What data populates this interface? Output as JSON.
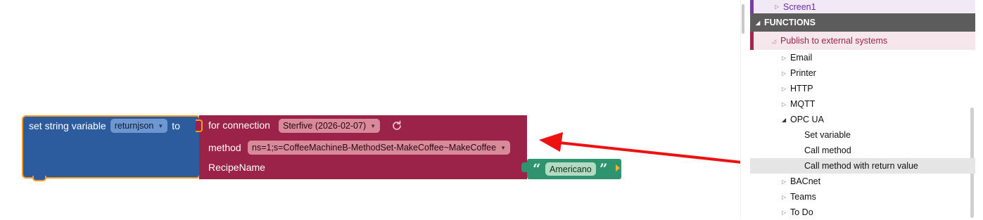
{
  "workspace": {
    "set_block": {
      "label_set": "set string variable",
      "variable": "returnjson",
      "label_to": "to"
    },
    "call_block": {
      "connection_label": "for connection",
      "connection_value": "Sterfive (2026-02-07)",
      "method_label": "method",
      "method_value": "ns=1;s=CoffeeMachineB-MethodSet-MakeCoffee~MakeCoffee",
      "param_label": "RecipeName"
    },
    "text_block": {
      "open_quote": "“",
      "value": "Americano",
      "close_quote": "”"
    },
    "colors": {
      "variable_block": "#2c5c9e",
      "opcua_block": "#9b2349",
      "text_block": "#2e9470",
      "selection_outline": "#f59a23",
      "arrow": "#ee1111"
    }
  },
  "toolbox": {
    "screen_item": "Screen1",
    "section_title": "FUNCTIONS",
    "category": "Publish to external systems",
    "items": [
      {
        "label": "Email",
        "expanded": false
      },
      {
        "label": "Printer",
        "expanded": false
      },
      {
        "label": "HTTP",
        "expanded": false
      },
      {
        "label": "MQTT",
        "expanded": false
      },
      {
        "label": "OPC UA",
        "expanded": true
      },
      {
        "label": "BACnet",
        "expanded": false
      },
      {
        "label": "Teams",
        "expanded": false
      },
      {
        "label": "To Do",
        "expanded": false
      }
    ],
    "opcua_children": [
      "Set variable",
      "Call method",
      "Call method with return value"
    ],
    "highlighted_item": "Call method with return value"
  }
}
